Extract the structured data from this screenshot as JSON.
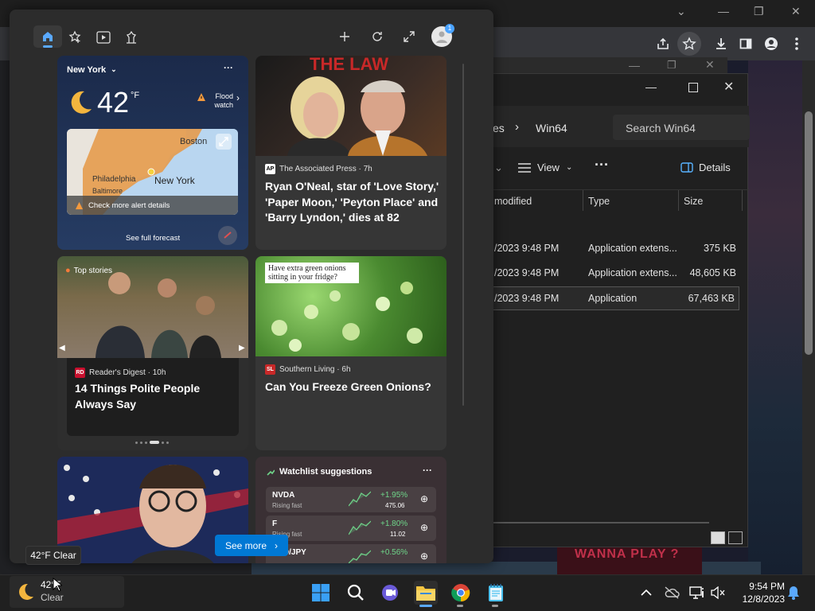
{
  "chrome": {
    "tabs_controls": [
      "⌄",
      "—",
      "❐",
      "✕"
    ]
  },
  "explorer": {
    "breadcrumb_partial": "es",
    "breadcrumb_current": "Win64",
    "search_placeholder": "Search Win64",
    "view_label": "View",
    "details_label": "Details",
    "columns": [
      "modified",
      "Type",
      "Size"
    ],
    "rows": [
      {
        "modified": "/2023 9:48 PM",
        "type": "Application extens...",
        "size": "375 KB"
      },
      {
        "modified": "/2023 9:48 PM",
        "type": "Application extens...",
        "size": "48,605 KB"
      },
      {
        "modified": "/2023 9:48 PM",
        "type": "Application",
        "size": "67,463 KB"
      }
    ]
  },
  "widgets": {
    "notification_count": "1",
    "weather": {
      "location": "New York",
      "temperature": "42",
      "unit": "°F",
      "alert": "Flood watch",
      "map_labels": [
        "Boston",
        "Philadelphia",
        "New York",
        "Baltimore"
      ],
      "alert_details": "Check more alert details",
      "forecast_button": "See full forecast"
    },
    "news1": {
      "source": "The Associated Press · 7h",
      "source_logo": "AP",
      "title": "Ryan O'Neal, star of 'Love Story,' 'Paper Moon,' 'Peyton Place' and 'Barry Lyndon,' dies at 82",
      "image_text": "THE LAW"
    },
    "top_stories": {
      "label": "Top stories",
      "source": "Reader's Digest · 10h",
      "title": "14 Things Polite People Always Say"
    },
    "news2": {
      "source": "Southern Living · 6h",
      "source_logo": "SL",
      "image_caption": "Have extra green onions sitting in your fridge?",
      "title": "Can You Freeze Green Onions?"
    },
    "watchlist": {
      "title": "Watchlist suggestions",
      "items": [
        {
          "symbol": "NVDA",
          "subtitle": "Rising fast",
          "change": "+1.95%",
          "price": "475.06"
        },
        {
          "symbol": "F",
          "subtitle": "Rising fast",
          "change": "+1.80%",
          "price": "11.02"
        },
        {
          "symbol": "USD/JPY",
          "subtitle": "",
          "change": "+0.56%",
          "price": ""
        }
      ]
    },
    "see_more": "See more",
    "weather_tooltip": "42°F Clear"
  },
  "taskbar": {
    "weather_temp": "42°F",
    "weather_cond": "Clear",
    "time": "9:54 PM",
    "date": "12/8/2023"
  },
  "colors": {
    "accent": "#0078d4",
    "positive": "#6fd68a",
    "weather_card": "#1f3357"
  },
  "background": {
    "game_text": "WANNA PLAY ?"
  }
}
